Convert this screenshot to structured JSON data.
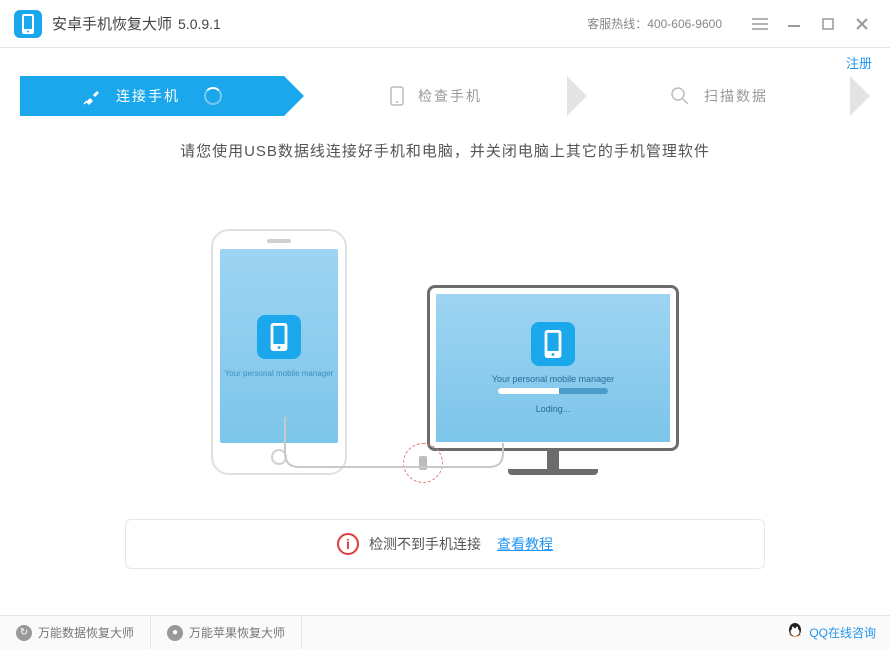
{
  "titlebar": {
    "app_name": "安卓手机恢复大师",
    "app_version": "5.0.9.1",
    "hotline_label": "客服热线：400-606-9600"
  },
  "register_label": "注册",
  "stepper": {
    "step1": "连接手机",
    "step2": "检查手机",
    "step3": "扫描数据"
  },
  "instruction": "请您使用USB数据线连接好手机和电脑，并关闭电脑上其它的手机管理软件",
  "device_tag": "Your personal mobile manager",
  "monitor_loading": "Loding...",
  "status": {
    "text": "检测不到手机连接",
    "tutorial": "查看教程"
  },
  "footer": {
    "btn1": "万能数据恢复大师",
    "btn2": "万能苹果恢复大师",
    "qq": "QQ在线咨询"
  }
}
